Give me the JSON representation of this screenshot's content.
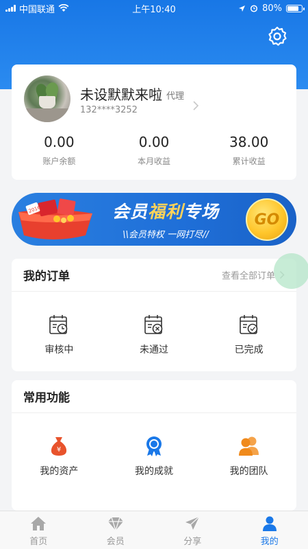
{
  "status_bar": {
    "carrier": "中国联通",
    "time": "上午10:40",
    "battery": "80%",
    "battery_level": 0.8
  },
  "profile": {
    "name": "未设默默来啦",
    "role": "代理",
    "phone": "132****3252",
    "stats": [
      {
        "value": "0.00",
        "label": "账户余额"
      },
      {
        "value": "0.00",
        "label": "本月收益"
      },
      {
        "value": "38.00",
        "label": "累计收益"
      }
    ]
  },
  "banner": {
    "title_part1": "会员",
    "title_highlight": "福利",
    "title_part2": "专场",
    "subtitle_1": "\\\\会员特权",
    "subtitle_2": "一网打尽//",
    "go": "GO",
    "gift_tag": "2016"
  },
  "orders": {
    "title": "我的订单",
    "view_all": "查看全部订单",
    "items": [
      {
        "label": "审核中",
        "icon": "calendar-clock-icon"
      },
      {
        "label": "未通过",
        "icon": "calendar-x-icon"
      },
      {
        "label": "已完成",
        "icon": "calendar-check-icon"
      }
    ]
  },
  "tools": {
    "title": "常用功能",
    "items": [
      {
        "label": "我的资产",
        "icon": "money-bag-icon"
      },
      {
        "label": "我的成就",
        "icon": "medal-icon"
      },
      {
        "label": "我的团队",
        "icon": "team-icon"
      }
    ]
  },
  "tabs": [
    {
      "label": "首页",
      "icon": "home-icon",
      "active": false
    },
    {
      "label": "会员",
      "icon": "diamond-icon",
      "active": false
    },
    {
      "label": "分享",
      "icon": "send-icon",
      "active": false
    },
    {
      "label": "我的",
      "icon": "user-icon",
      "active": true
    }
  ],
  "colors": {
    "brand_blue": "#1a78e8",
    "gold": "#ffc62b",
    "orange": "#f08a1c",
    "tool_red": "#e8532c"
  }
}
